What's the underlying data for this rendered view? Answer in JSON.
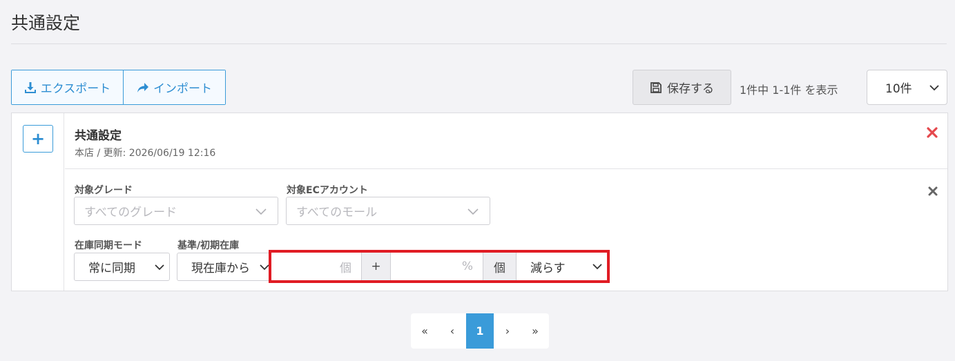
{
  "page": {
    "title": "共通設定"
  },
  "toolbar": {
    "export_label": "エクスポート",
    "import_label": "インポート",
    "save_label": "保存する",
    "count_text": "1件中 1-1件 を表示",
    "per_page": "10件"
  },
  "card": {
    "add_button": "+",
    "title": "共通設定",
    "subtitle": "本店 / 更新: 2026/06/19 12:16",
    "grade_label": "対象グレード",
    "grade_placeholder": "すべてのグレード",
    "account_label": "対象ECアカウント",
    "account_placeholder": "すべてのモール",
    "sync_mode_label": "在庫同期モード",
    "sync_mode_value": "常に同期",
    "base_stock_label": "基準/初期在庫",
    "base_stock_value": "現在庫から",
    "qty_placeholder": "個",
    "plus_addon": "+",
    "pct_placeholder": "%",
    "unit_addon": "個",
    "direction_value": "減らす"
  },
  "pagination": {
    "first": "«",
    "prev": "‹",
    "current": "1",
    "next": "›",
    "last": "»"
  },
  "colors": {
    "accent": "#3a9bd9",
    "danger": "#e5484d",
    "highlight": "#e01c24"
  }
}
